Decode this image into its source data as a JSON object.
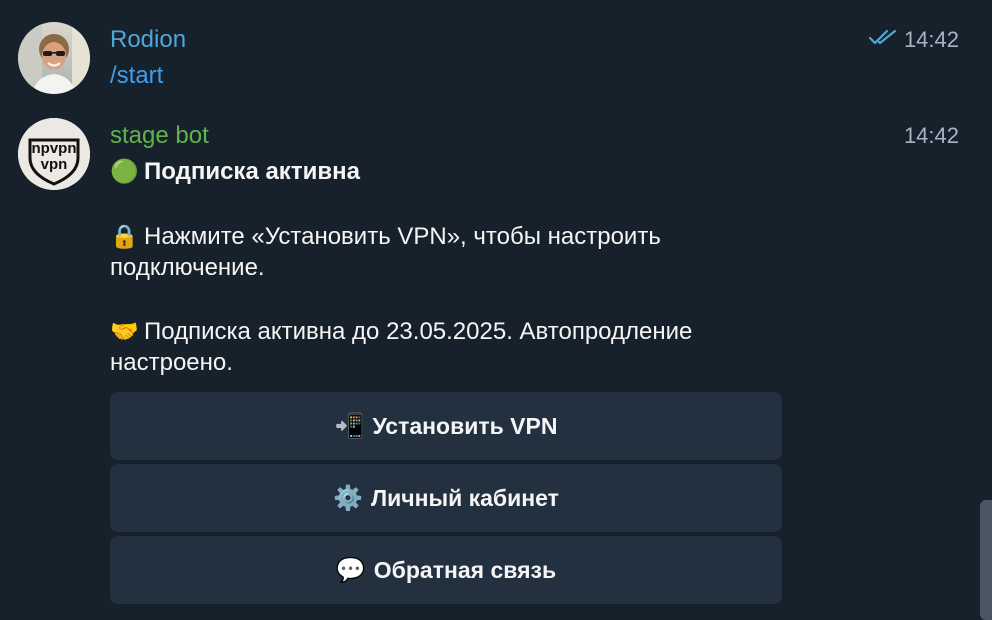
{
  "messages": [
    {
      "sender": "Rodion",
      "sender_color": "#4fa6d8",
      "time": "14:42",
      "status_icon": "double-check-icon",
      "text": "/start",
      "text_color": "#3e9ff0"
    },
    {
      "sender": "stage bot",
      "sender_color": "#5fb34a",
      "time": "14:42",
      "avatar_line1": "npvpn",
      "avatar_line2": "vpn",
      "status_line": {
        "emoji": "🟢",
        "text": "Подписка активна"
      },
      "para1": {
        "emoji": "🔒",
        "line1": "Нажмите «Установить VPN», чтобы настроить",
        "line2": "подключение."
      },
      "para2": {
        "emoji": "🤝",
        "line1": "Подписка активна до 23.05.2025. Автопродление",
        "line2": "настроено."
      },
      "buttons": [
        {
          "icon": "📲",
          "label": "Установить VPN"
        },
        {
          "icon": "⚙️",
          "label": "Личный кабинет"
        },
        {
          "icon": "💬",
          "label": "Обратная связь"
        }
      ]
    }
  ],
  "colors": {
    "background": "#17212b",
    "button_bg": "#223040",
    "time": "#a7b4c1",
    "check": "#4fa6d8"
  }
}
